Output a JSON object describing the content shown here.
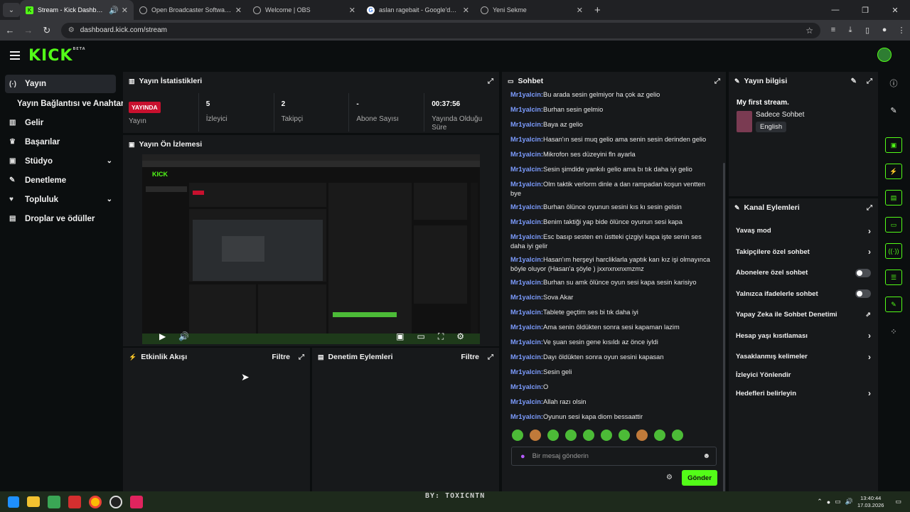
{
  "browser": {
    "tabs": [
      {
        "title": "Stream - Kick Dashboard",
        "active": true
      },
      {
        "title": "Open Broadcaster Software | OBS",
        "active": false
      },
      {
        "title": "Welcome | OBS",
        "active": false
      },
      {
        "title": "aslan ragebait - Google'da Ara",
        "active": false
      },
      {
        "title": "Yeni Sekme",
        "active": false
      }
    ],
    "url": "dashboard.kick.com/stream"
  },
  "brand": {
    "logo": "KICK",
    "beta": "BETA",
    "accent": "#53fc18"
  },
  "sidebar": {
    "items": [
      {
        "label": "Yayın",
        "icon": "broadcast-icon"
      },
      {
        "label": "Yayın Bağlantısı ve Anahtarı",
        "icon": ""
      },
      {
        "label": "Gelir",
        "icon": "chart-icon"
      },
      {
        "label": "Başarılar",
        "icon": "trophy-icon"
      },
      {
        "label": "Stüdyo",
        "icon": "studio-icon"
      },
      {
        "label": "Denetleme",
        "icon": "wrench-icon"
      },
      {
        "label": "Topluluk",
        "icon": "community-icon"
      },
      {
        "label": "Droplar ve ödüller",
        "icon": "drops-icon"
      }
    ]
  },
  "stats": {
    "title": "Yayın İstatistikleri",
    "badge": "YAYINDA",
    "items": [
      {
        "value": "",
        "label": "Yayın"
      },
      {
        "value": "5",
        "label": "İzleyici"
      },
      {
        "value": "2",
        "label": "Takipçi"
      },
      {
        "value": "-",
        "label": "Abone Sayısı"
      },
      {
        "value": "00:37:56",
        "label": "Yayında Olduğu Süre"
      }
    ]
  },
  "preview": {
    "title": "Yayın Ön İzlemesi"
  },
  "activity": {
    "title": "Etkinlik Akışı",
    "filter": "Filtre"
  },
  "moderation": {
    "title": "Denetim Eylemleri",
    "filter": "Filtre"
  },
  "chat": {
    "title": "Sohbet",
    "messages": [
      {
        "user": "Mr1yalcin",
        "text": "Bu arada sesin gelmiyor ha çok az gelio"
      },
      {
        "user": "Mr1yalcin",
        "text": "Burhan sesin gelmio"
      },
      {
        "user": "Mr1yalcin",
        "text": "Baya az gelio"
      },
      {
        "user": "Mr1yalcin",
        "text": "Hasan'ın sesi muq gelio ama senin sesin derinden gelio"
      },
      {
        "user": "Mr1yalcin",
        "text": "Mikrofon ses düzeyini fln ayarla"
      },
      {
        "user": "Mr1yalcin",
        "text": "Sesin şimdide yankılı gelio ama bı tık daha iyi gelio"
      },
      {
        "user": "Mr1yalcin",
        "text": "Olm taktik verlorm dinle a dan rampadan koşun ventten bye"
      },
      {
        "user": "Mr1yalcin",
        "text": "Burhan ölünce oyunun sesini kıs kı sesin gelsin"
      },
      {
        "user": "Mr1yalcin",
        "text": "Benim taktiği yap bide ölünce oyunun sesi kapa"
      },
      {
        "user": "Mr1yalcin",
        "text": "Esc basıp sesten en üstteki çizgiyi kapa işte senin ses daha iyi gelir"
      },
      {
        "user": "Mr1yalcin",
        "text": "Hasan'ım herşeyi harcliklarla yaptık karı kız işi olmayınca böyle oluyor (Hasan'a şöyle ) jxxnxnxnxmzmz"
      },
      {
        "user": "Mr1yalcin",
        "text": "Burhan su amk ölünce oyun sesi kapa sesin karisiyo"
      },
      {
        "user": "Mr1yalcin",
        "text": "Sova Akar"
      },
      {
        "user": "Mr1yalcin",
        "text": "Tablete geçtim ses bi tık daha iyi"
      },
      {
        "user": "Mr1yalcin",
        "text": "Ama senin öldükten sonra sesi kapaman lazim"
      },
      {
        "user": "Mr1yalcin",
        "text": "Ve şuan sesin gene kısıldı az önce iyldi"
      },
      {
        "user": "Mr1yalcin",
        "text": "Dayı öldükten sonra oyun sesini kapasan"
      },
      {
        "user": "Mr1yalcin",
        "text": "Sesin geli"
      },
      {
        "user": "Mr1yalcin",
        "text": "O"
      },
      {
        "user": "Mr1yalcin",
        "text": "Allah razı olsin"
      },
      {
        "user": "Mr1yalcin",
        "text": "Oyunun sesi kapa diom bessaattir"
      }
    ],
    "input_placeholder": "Bir mesaj gönderin",
    "send_label": "Gönder"
  },
  "stream_info": {
    "title": "Yayın bilgisi",
    "stream_title": "My first stream.",
    "category": "Sadece Sohbet",
    "language": "English"
  },
  "channel_actions": {
    "title": "Kanal Eylemleri",
    "items": [
      {
        "label": "Yavaş mod",
        "control": "chevron"
      },
      {
        "label": "Takipçilere özel sohbet",
        "control": "chevron"
      },
      {
        "label": "Abonelere özel sohbet",
        "control": "toggle"
      },
      {
        "label": "Yalnızca ifadelerle sohbet",
        "control": "toggle"
      },
      {
        "label": "Yapay Zeka ile Sohbet Denetimi",
        "control": "external"
      },
      {
        "label": "Hesap yaşı kısıtlaması",
        "control": "chevron"
      },
      {
        "label": "Yasaklanmış kelimeler",
        "control": "chevron"
      },
      {
        "label": "İzleyici Yönlendir",
        "control": "none"
      },
      {
        "label": "Hedefleri belirleyin",
        "control": "chevron"
      }
    ]
  },
  "taskbar": {
    "watermark": "BY: TOXICNTN",
    "time": "13:40:44",
    "date": "17.03.2026"
  }
}
